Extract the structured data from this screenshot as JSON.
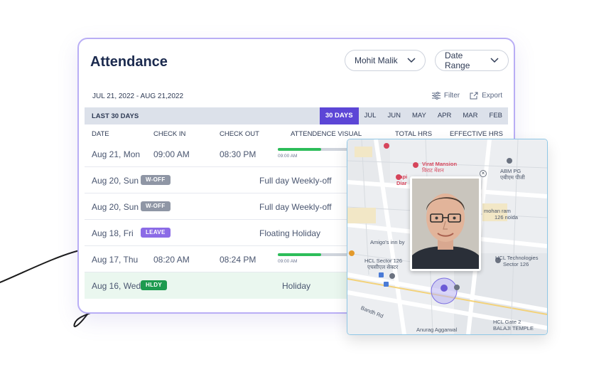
{
  "header": {
    "title": "Attendance"
  },
  "filters": {
    "employee_select": "Mohit Malik",
    "date_range_select": "Date Range"
  },
  "toolbar": {
    "range_label": "JUL 21, 2022 - AUG 21,2022",
    "filter_label": "Filter",
    "export_label": "Export"
  },
  "period_bar": {
    "label": "LAST 30 DAYS",
    "tabs": [
      "30 DAYS",
      "JUL",
      "JUN",
      "MAY",
      "APR",
      "MAR",
      "FEB"
    ],
    "active_tab": "30 DAYS"
  },
  "table": {
    "columns": [
      "DATE",
      "CHECK IN",
      "CHECK OUT",
      "ATTENDENCE VISUAL",
      "TOTAL HRS",
      "EFFECTIVE HRS"
    ],
    "rows": [
      {
        "date": "Aug 21, Mon",
        "check_in": "09:00 AM",
        "check_out": "08:30 PM",
        "visual_start": "09:00 AM"
      },
      {
        "date": "Aug 20, Sun",
        "badge": "W-OFF",
        "note": "Full day Weekly-off"
      },
      {
        "date": "Aug 20, Sun",
        "badge": "W-OFF",
        "note": "Full day Weekly-off"
      },
      {
        "date": "Aug 18, Fri",
        "badge": "LEAVE",
        "note": "Floating Holiday"
      },
      {
        "date": "Aug 17, Thu",
        "check_in": "08:20 AM",
        "check_out": "08:24 PM",
        "visual_start": "09:00 AM"
      },
      {
        "date": "Aug 16, Wed",
        "badge": "HLDY",
        "note": "Holiday"
      }
    ]
  },
  "map_popup": {
    "labels": {
      "virat_mansion": "Virat Mansion",
      "virat_mansion_hindi": "विराट मेंशन",
      "capi": "Capi",
      "diar": "Diar",
      "abm_pg": "ABM PG",
      "abm_pg_hindi": "एबीएम पीजी",
      "mohan_ram": "mohan ram",
      "noida": "126 noida",
      "amigos": "Amigo's inn by",
      "hcl_sector": "HCL Sector 126",
      "hcl_sector_hindi": "एचसीएल सेक्टर",
      "hcl_tech": "HCL Technologies",
      "hcl_tech_sector": "Sector 126",
      "bandh_rd": "Bandh Rd",
      "hcl_gate": "HCL Gate 2",
      "balaji": "BALAJI TEMPLE",
      "anurag": "Anurag Aggarwal"
    }
  },
  "colors": {
    "accent": "#5c46d6",
    "card_border": "#b9aef5",
    "woff": "#8f96a5",
    "leave": "#8b6be6",
    "hldy": "#1d9a4f",
    "progress": "#2dbd5a"
  }
}
